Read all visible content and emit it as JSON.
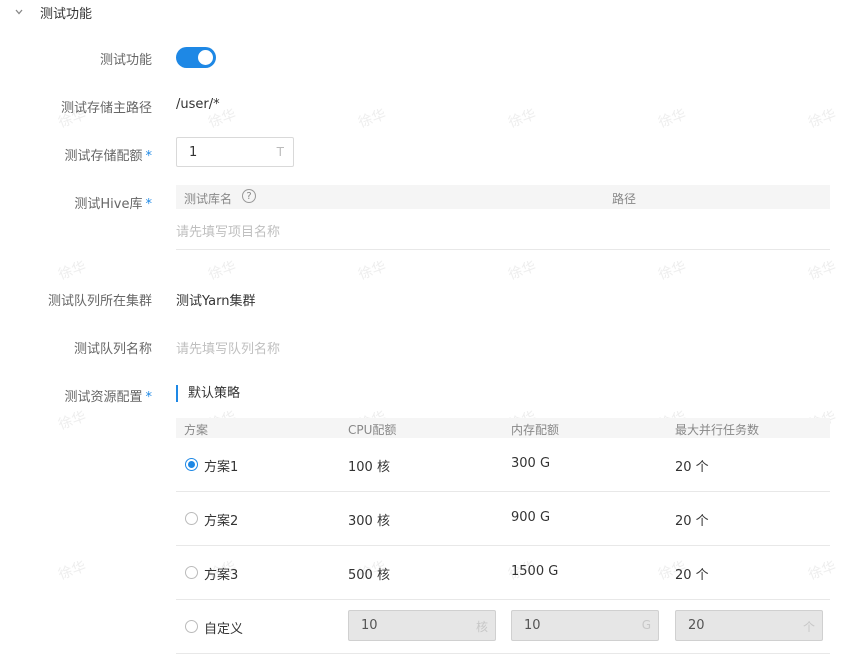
{
  "section": {
    "title": "测试功能"
  },
  "form": {
    "toggle_label": "测试功能",
    "toggle_on": true,
    "storage_path_label": "测试存储主路径",
    "storage_path_value": "/user/*",
    "storage_quota_label": "测试存储配额",
    "storage_quota_value": "1",
    "storage_quota_unit": "T",
    "hive_label": "测试Hive库",
    "queue_cluster_label": "测试队列所在集群",
    "queue_cluster_value": "测试Yarn集群",
    "queue_name_label": "测试队列名称",
    "queue_name_placeholder": "请先填写队列名称",
    "resource_label": "测试资源配置",
    "required_mark": "*"
  },
  "hive_table": {
    "col_name": "测试库名",
    "help_icon": "?",
    "col_path": "路径",
    "empty_placeholder": "请先填写项目名称"
  },
  "resource": {
    "strategy_title": "默认策略",
    "headers": [
      "方案",
      "CPU配额",
      "内存配额",
      "最大并行任务数"
    ],
    "rows": [
      {
        "name": "方案1",
        "cpu": "100 核",
        "mem": "300 G",
        "parallel": "20 个",
        "checked": true
      },
      {
        "name": "方案2",
        "cpu": "300 核",
        "mem": "900 G",
        "parallel": "20 个",
        "checked": false
      },
      {
        "name": "方案3",
        "cpu": "500 核",
        "mem": "1500 G",
        "parallel": "20 个",
        "checked": false
      }
    ],
    "custom": {
      "name": "自定义",
      "cpu_value": "10",
      "cpu_unit": "核",
      "mem_value": "10",
      "mem_unit": "G",
      "parallel_value": "20",
      "parallel_unit": "个"
    }
  },
  "watermark": "徐华",
  "colors": {
    "accent": "#1e88e5"
  }
}
